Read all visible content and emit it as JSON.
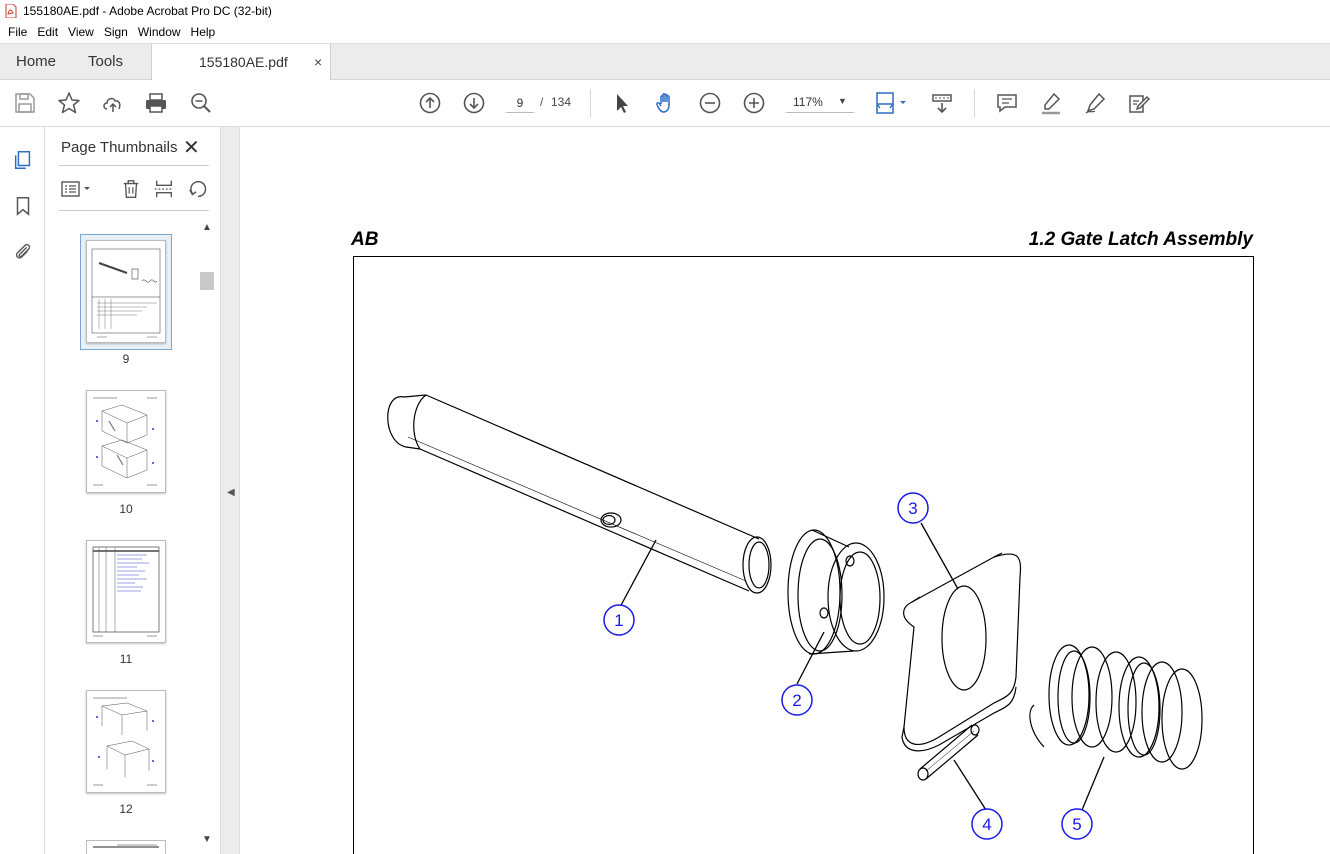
{
  "window": {
    "title": "155180AE.pdf - Adobe Acrobat Pro DC (32-bit)"
  },
  "menu": [
    "File",
    "Edit",
    "View",
    "Sign",
    "Window",
    "Help"
  ],
  "tabs": {
    "home": "Home",
    "tools": "Tools",
    "document": "155180AE.pdf",
    "close": "×"
  },
  "toolbar": {
    "current_page": "9",
    "page_separator": "/",
    "total_pages": "134",
    "zoom": "117%"
  },
  "thumbnails_panel": {
    "title": "Page Thumbnails",
    "pages": [
      "9",
      "10",
      "11",
      "12"
    ]
  },
  "document": {
    "header_left": "AB",
    "header_right": "1.2  Gate Latch Assembly",
    "callouts": [
      "1",
      "2",
      "3",
      "4",
      "5"
    ]
  },
  "colors": {
    "callout": "#1a1ae6",
    "selected_thumb": "#7aa6d4",
    "icon_blue": "#2b6cc4"
  }
}
